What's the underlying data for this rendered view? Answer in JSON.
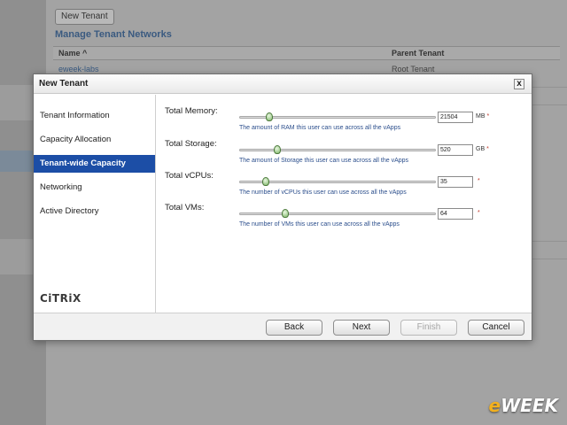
{
  "background": {
    "new_tenant_button": "New Tenant",
    "section_title": "Manage Tenant Networks",
    "table": {
      "columns": [
        "Name ^",
        "Parent Tenant"
      ],
      "rows": [
        [
          "eweek-labs",
          "Root Tenant"
        ]
      ]
    }
  },
  "dialog": {
    "title": "New Tenant",
    "close_label": "x",
    "nav": [
      {
        "label": "Tenant Information",
        "active": false
      },
      {
        "label": "Capacity Allocation",
        "active": false
      },
      {
        "label": "Tenant-wide Capacity",
        "active": true
      },
      {
        "label": "Networking",
        "active": false
      },
      {
        "label": "Active Directory",
        "active": false
      }
    ],
    "logo_text": "CiTRiX",
    "fields": [
      {
        "label": "Total Memory:",
        "value": "21504",
        "unit": "MB",
        "required": "*",
        "help": "The amount of RAM this user can use across all the vApps",
        "slider_fraction": 0.15
      },
      {
        "label": "Total Storage:",
        "value": "520",
        "unit": "GB",
        "required": "*",
        "help": "The amount of Storage this user can use across all the vApps",
        "slider_fraction": 0.19
      },
      {
        "label": "Total vCPUs:",
        "value": "35",
        "unit": "",
        "required": "*",
        "help": "The number of vCPUs this user can use across all the vApps",
        "slider_fraction": 0.13
      },
      {
        "label": "Total VMs:",
        "value": "64",
        "unit": "",
        "required": "*",
        "help": "The number of VMs this user can use across all the vApps",
        "slider_fraction": 0.23
      }
    ],
    "buttons": {
      "back": "Back",
      "next": "Next",
      "finish": "Finish",
      "cancel": "Cancel"
    }
  },
  "watermark": {
    "prefix": "e",
    "suffix": "WEEK"
  },
  "colors": {
    "nav_active": "#1c4ea6",
    "help_text": "#2b4e8c",
    "required": "#c0392b",
    "slider_thumb": "#7fb86a"
  }
}
